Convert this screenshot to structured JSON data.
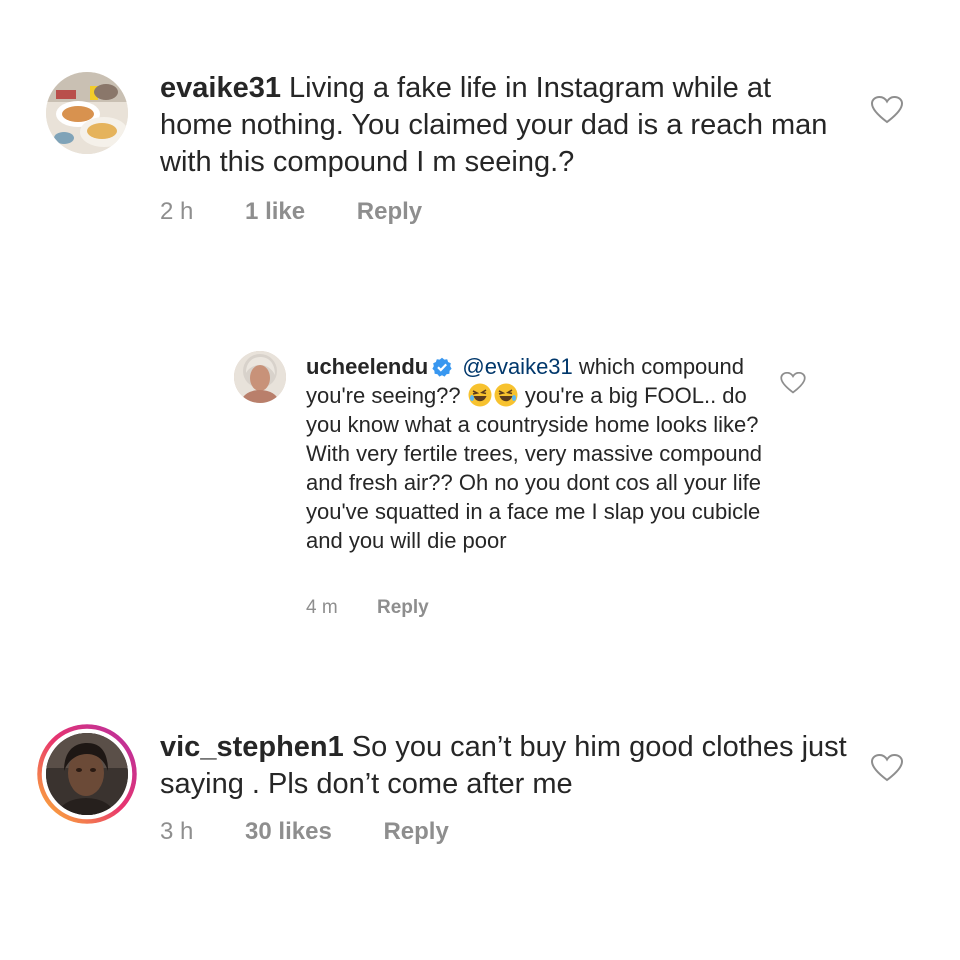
{
  "comments": [
    {
      "username": "evaike31",
      "text": "Living a fake life in Instagram while at home nothing. You claimed your dad is a reach man with this compound I m seeing.?",
      "time": "2 h",
      "likes": "1 like",
      "reply": "Reply",
      "avatar": "food-plate-avatar"
    },
    {
      "username": "vic_stephen1",
      "text": "So you can’t buy him good clothes just saying . Pls don’t come after me",
      "time": "3 h",
      "likes": "30 likes",
      "reply": "Reply",
      "avatar": "selfie-avatar",
      "story_ring": true
    }
  ],
  "reply": {
    "username": "ucheelendu",
    "verified": true,
    "mention": "@evaike31",
    "text_before_emoji": "which compound you're seeing??",
    "emoji": "rolling-on-the-floor-laughing-emoji",
    "text_after_emoji": "you're a big FOOL.. do you know what a countryside home looks like? With very fertile trees, very massive compound and fresh air?? Oh no you dont cos all your life you've squatted in a face me I slap you cubicle and you will die poor",
    "time": "4 m",
    "reply": "Reply",
    "avatar": "woman-portrait-avatar"
  },
  "colors": {
    "text": "#262626",
    "meta": "#8e8e8e",
    "mention": "#00376b",
    "verified": "#3897f0",
    "heart_outline": "#8e8e8e"
  },
  "icons": [
    "heart-outline-icon",
    "verified-badge-icon"
  ]
}
